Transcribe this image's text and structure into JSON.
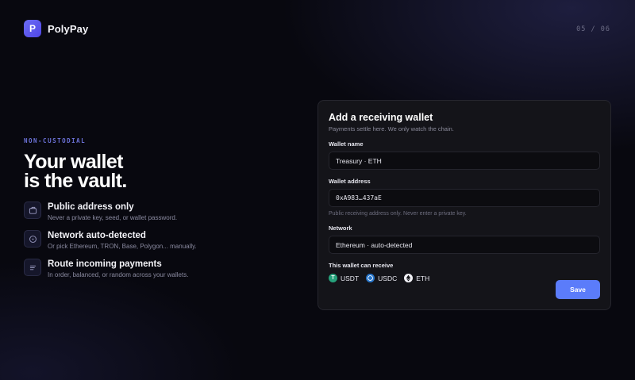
{
  "brand": {
    "logo_letter": "P",
    "name": "PolyPay"
  },
  "step": "05 / 06",
  "hero": {
    "eyebrow": "NON-CUSTODIAL",
    "headline_line1": "Your wallet",
    "headline_line2": "is the vault.",
    "features": [
      {
        "icon": "wallet-icon",
        "title": "Public address only",
        "desc": "Never a private key, seed, or wallet password."
      },
      {
        "icon": "clock-icon",
        "title": "Network auto-detected",
        "desc": "Or pick Ethereum, TRON, Base, Polygon... manually."
      },
      {
        "icon": "list-icon",
        "title": "Route incoming payments",
        "desc": "In order, balanced, or random across your wallets."
      }
    ]
  },
  "form": {
    "title": "Add a receiving wallet",
    "subtitle": "Payments settle here. We only watch the chain.",
    "wallet_name_label": "Wallet name",
    "wallet_name_value": "Treasury · ETH",
    "wallet_address_label": "Wallet address",
    "wallet_address_value": "0xA983…437aE",
    "wallet_address_hint": "Public receiving address only. Never enter a private key.",
    "network_label": "Network",
    "network_value": "Ethereum · auto-detected",
    "receive_label": "This wallet can receive",
    "assets": [
      {
        "icon": "usdt-icon",
        "name": "USDT",
        "color": "#26a17b"
      },
      {
        "icon": "usdc-icon",
        "name": "USDC",
        "color": "#2775ca"
      },
      {
        "icon": "eth-icon",
        "name": "ETH",
        "color": "#f2f2f7"
      }
    ],
    "save_label": "Save"
  },
  "colors": {
    "accent": "#5b7cfa",
    "brand": "#5a55f0",
    "eyebrow": "#6c72d8"
  }
}
